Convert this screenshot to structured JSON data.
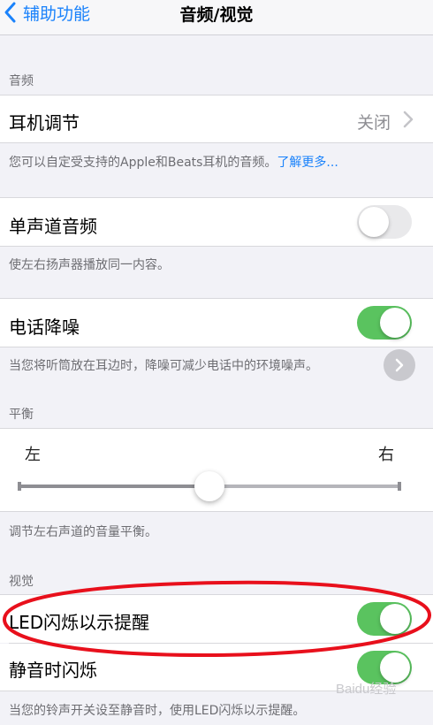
{
  "nav": {
    "back_label": "辅助功能",
    "title": "音频/视觉"
  },
  "audio": {
    "header": "音频",
    "headphone": {
      "label": "耳机调节",
      "value": "关闭",
      "footer": "您可以自定受支持的Apple和Beats耳机的音频。",
      "footer_link": "了解更多..."
    }
  },
  "mono": {
    "label": "单声道音频",
    "on": false,
    "footer": "使左右扬声器播放同一内容。"
  },
  "noise": {
    "label": "电话降噪",
    "on": true,
    "footer": "当您将听筒放在耳边时，降噪可减少电话中的环境噪声。"
  },
  "balance": {
    "header": "平衡",
    "left_label": "左",
    "right_label": "右",
    "value": 0.5,
    "footer": "调节左右声道的音量平衡。"
  },
  "visual": {
    "header": "视觉",
    "led_flash": {
      "label": "LED闪烁以示提醒",
      "on": true
    },
    "silent_flash": {
      "label": "静音时闪烁",
      "on": true
    },
    "footer": "当您的铃声开关设至静音时，使用LED闪烁以示提醒。"
  },
  "annotation": {
    "color": "#e8101c"
  },
  "watermark": "Baidu经验",
  "colors": {
    "accent": "#1a82fb",
    "toggle_on": "#5ac35f",
    "background": "#f2f2f7"
  }
}
